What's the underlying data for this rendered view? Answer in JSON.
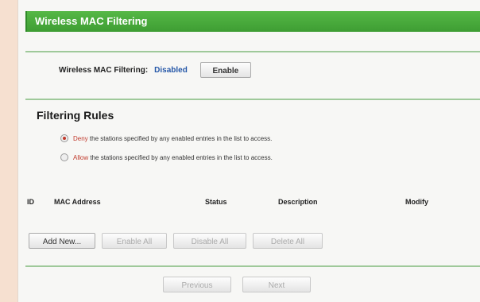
{
  "page": {
    "title": "Wireless MAC Filtering"
  },
  "status": {
    "label": "Wireless MAC Filtering:",
    "value": "Disabled",
    "enable_button": "Enable"
  },
  "filtering_rules": {
    "heading": "Filtering Rules",
    "options": [
      {
        "keyword": "Deny",
        "text": " the stations specified by any enabled entries in the list to access.",
        "checked": true
      },
      {
        "keyword": "Allow",
        "text": " the stations specified by any enabled entries in the list to access.",
        "checked": false
      }
    ]
  },
  "table": {
    "columns": [
      "ID",
      "MAC Address",
      "Status",
      "Description",
      "Modify"
    ],
    "rows": []
  },
  "actions": {
    "add_new": "Add New...",
    "enable_all": "Enable All",
    "disable_all": "Disable All",
    "delete_all": "Delete All"
  },
  "pager": {
    "previous": "Previous",
    "next": "Next"
  },
  "colors": {
    "accent": "#4aad3e",
    "status_value": "#2557a8",
    "keyword": "#c0392b"
  }
}
